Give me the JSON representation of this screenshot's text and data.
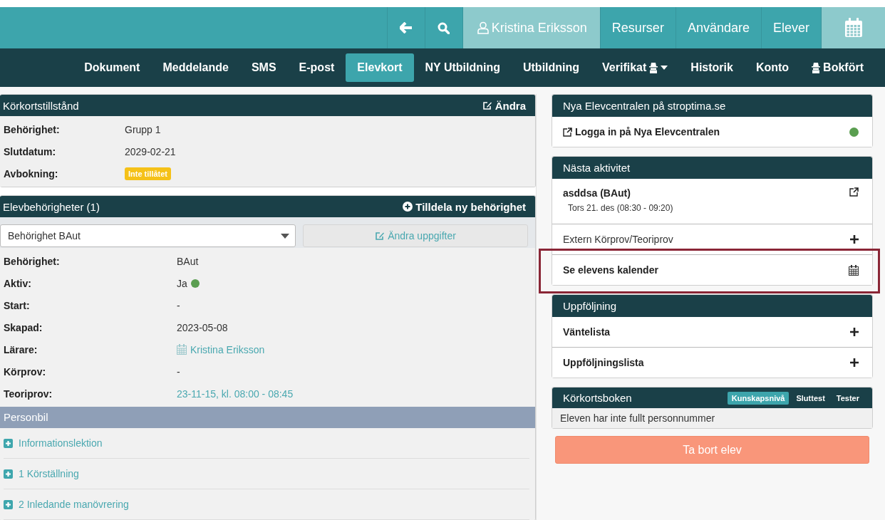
{
  "top_bar": {
    "items": [
      {
        "kind": "back",
        "selected": false
      },
      {
        "kind": "search",
        "selected": false
      },
      {
        "kind": "user",
        "label": "Kristina Eriksson",
        "selected": true
      },
      {
        "kind": "text",
        "label": "Resurser",
        "selected": false
      },
      {
        "kind": "text",
        "label": "Användare",
        "selected": false
      },
      {
        "kind": "text",
        "label": "Elever",
        "selected": false
      },
      {
        "kind": "calendar",
        "selected": true
      }
    ]
  },
  "nav_tabs": [
    {
      "label": "Dokument",
      "selected": false
    },
    {
      "label": "Meddelande",
      "selected": false
    },
    {
      "label": "SMS",
      "selected": false
    },
    {
      "label": "E-post",
      "selected": false
    },
    {
      "label": "Elevkort",
      "selected": true
    },
    {
      "label": "NY Utbildning",
      "selected": false
    },
    {
      "label": "Utbildning",
      "selected": false
    },
    {
      "label": "Verifikat",
      "selected": false,
      "icon_after": true,
      "dropdown": true
    },
    {
      "label": "Historik",
      "selected": false
    },
    {
      "label": "Konto",
      "selected": false
    },
    {
      "label": "Bokfört",
      "selected": false,
      "icon_before": true
    }
  ],
  "permit_panel": {
    "title": "Körkortstillstånd",
    "action": "Ändra",
    "rows": [
      {
        "label": "Behörighet:",
        "value": "Grupp 1",
        "kind": "text"
      },
      {
        "label": "Slutdatum:",
        "value": "2029-02-21",
        "kind": "text"
      },
      {
        "label": "Avbokning:",
        "value": "Inte tillåtet",
        "kind": "badge"
      }
    ]
  },
  "authorizations_panel": {
    "title": "Elevbehörigheter (1)",
    "action": "Tilldela ny behörighet",
    "select_value": "Behörighet BAut",
    "edit_button": "Ändra uppgifter",
    "rows": [
      {
        "label": "Behörighet:",
        "value": "BAut",
        "kind": "text"
      },
      {
        "label": "Aktiv:",
        "value": "Ja",
        "kind": "dot",
        "color": "#5a9e50"
      },
      {
        "label": "Start:",
        "value": "-",
        "kind": "text"
      },
      {
        "label": "Skapad:",
        "value": "2023-05-08",
        "kind": "text"
      },
      {
        "label": "Lärare:",
        "value": "Kristina Eriksson",
        "kind": "calendar_link"
      },
      {
        "label": "Körprov:",
        "value": "-",
        "kind": "text"
      },
      {
        "label": "Teoriprov:",
        "value": "23-11-15, kl. 08:00 - 08:45",
        "kind": "link"
      }
    ],
    "section_title": "Personbil",
    "lessons": [
      {
        "label": "Informationslektion",
        "expanded": false
      },
      {
        "label": "1 Körställning",
        "expanded": false
      },
      {
        "label": "2 Inledande manövrering",
        "expanded": false
      }
    ]
  },
  "elevcentral_panel": {
    "title": "Nya Elevcentralen på stroptima.se",
    "link": "Logga in på Nya Elevcentralen",
    "online": true
  },
  "next_activity_panel": {
    "title": "Nästa aktivitet",
    "activity_title": "asddsa (BAut)",
    "activity_time": "Tors 21. des (08:30 - 09:20)",
    "items": [
      {
        "label": "Extern Körprov/Teoriprov",
        "kind": "plus",
        "bold": false,
        "highlighted": false
      },
      {
        "label": "Se elevens kalender",
        "kind": "calendar",
        "bold": true,
        "highlighted": true
      }
    ]
  },
  "followup_panel": {
    "title": "Uppföljning",
    "items": [
      {
        "label": "Väntelista"
      },
      {
        "label": "Uppföljningslista"
      }
    ]
  },
  "licensebook_panel": {
    "title": "Körkortsboken",
    "tabs": [
      {
        "label": "Kunskapsnivå",
        "selected": true
      },
      {
        "label": "Sluttest",
        "selected": false
      },
      {
        "label": "Tester",
        "selected": false
      }
    ],
    "message": "Eleven har inte fullt personnummer"
  },
  "delete_button": "Ta bort elev"
}
